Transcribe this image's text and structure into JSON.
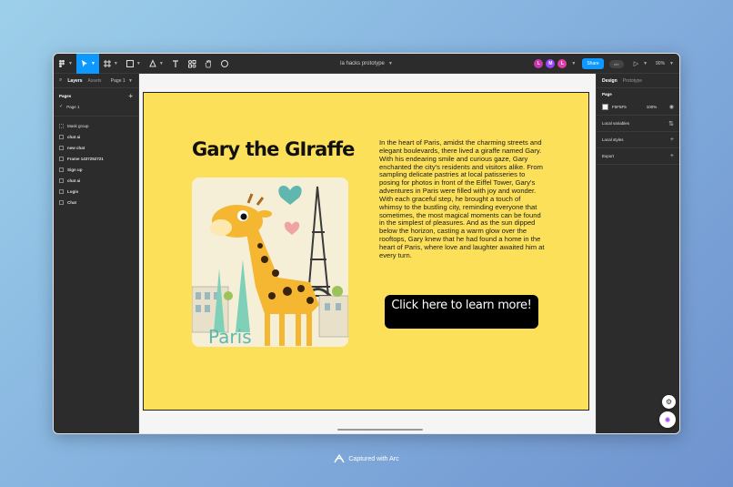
{
  "app": {
    "file_title": "la hacks prototype",
    "share_label": "Share",
    "code_label": "</>",
    "zoom": "90%",
    "avatars": [
      {
        "letter": "L",
        "color": "#c837ab"
      },
      {
        "letter": "M",
        "color": "#9747ff"
      },
      {
        "letter": "L",
        "color": "#e03da6"
      }
    ]
  },
  "left_panel": {
    "tabs": [
      "Layers",
      "Assets"
    ],
    "page_selector": "Page 1",
    "pages_header": "Pages",
    "pages": [
      "Page 1"
    ],
    "layers": [
      "Mask group",
      "chat ai",
      "new chat",
      "Frame 1437252721",
      "Sign up",
      "chat ai",
      "Login",
      "Chat"
    ]
  },
  "right_panel": {
    "tabs": [
      "Design",
      "Prototype"
    ],
    "page_section_title": "Page",
    "page_color": "F5F5F5",
    "page_opacity": "100%",
    "sections": [
      "Local variables",
      "Local styles",
      "Export"
    ]
  },
  "frame": {
    "title": "Gary the GIraffe",
    "story": "In the heart of Paris, amidst the charming streets and elegant boulevards, there lived a giraffe named Gary. With his endearing smile and curious gaze, Gary enchanted the city's residents and visitors alike. From sampling delicate pastries at local patisseries to posing for photos in front of the Eiffel Tower, Gary's adventures in Paris were filled with joy and wonder. With each graceful step, he brought a touch of whimsy to the bustling city, reminding everyone that sometimes, the most magical moments can be found in the simplest of pleasures. And as the sun dipped below the horizon, casting a warm glow over the rooftops, Gary knew that he had found a home in the heart of Paris, where love and laughter awaited him at every turn.",
    "button_label": "Click here to learn more!",
    "illustration_text": "Paris",
    "bg_color": "#fce05a"
  },
  "footer": {
    "captured_label": "Captured with Arc"
  }
}
